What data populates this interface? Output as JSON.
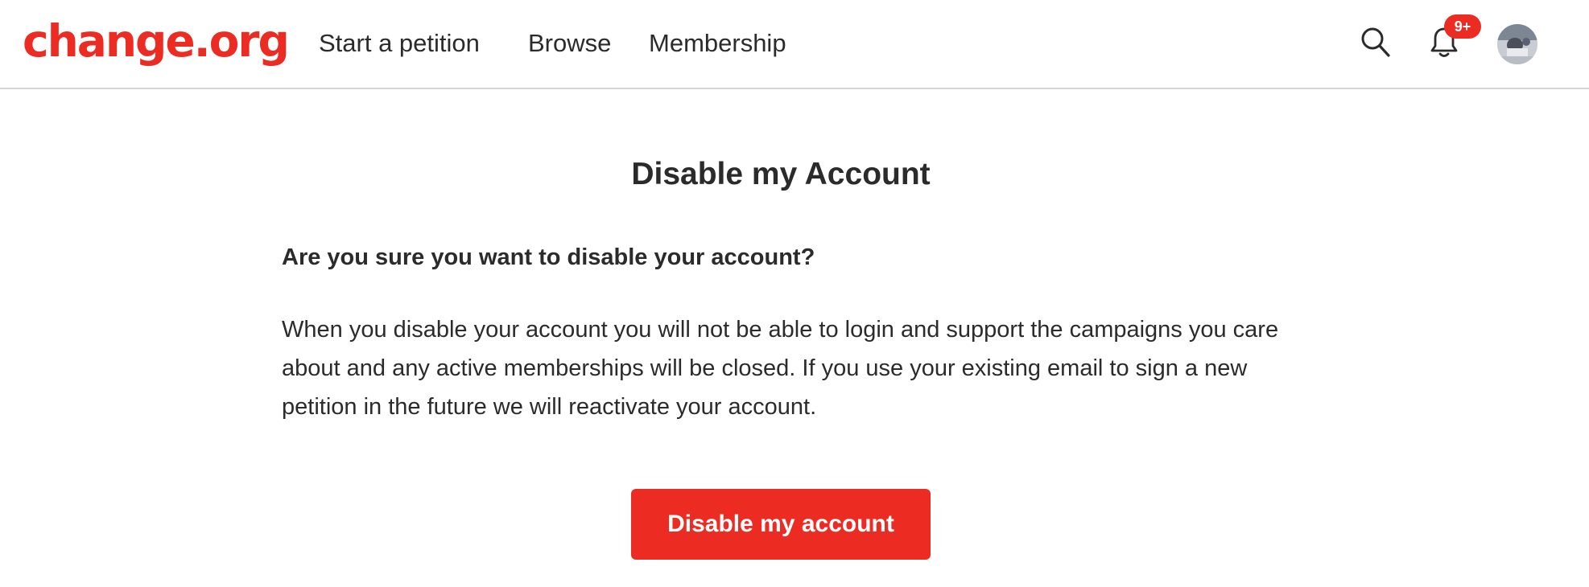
{
  "header": {
    "logo_text": "change.org",
    "nav": {
      "start_petition": "Start a petition",
      "browse": "Browse",
      "membership": "Membership"
    },
    "notifications_badge": "9+",
    "icons": [
      "search-icon",
      "bell-icon",
      "avatar"
    ]
  },
  "main": {
    "title": "Disable my Account",
    "question": "Are you sure you want to disable your account?",
    "description": "When you disable your account you will not be able to login and support the campaigns you care about and any active memberships will be closed. If you use your existing email to sign a new petition in the future we will reactivate your account.",
    "disable_button_label": "Disable my account"
  },
  "colors": {
    "brand_red": "#ec2c22",
    "text": "#2b2b2b",
    "divider": "#d6d6d6"
  }
}
